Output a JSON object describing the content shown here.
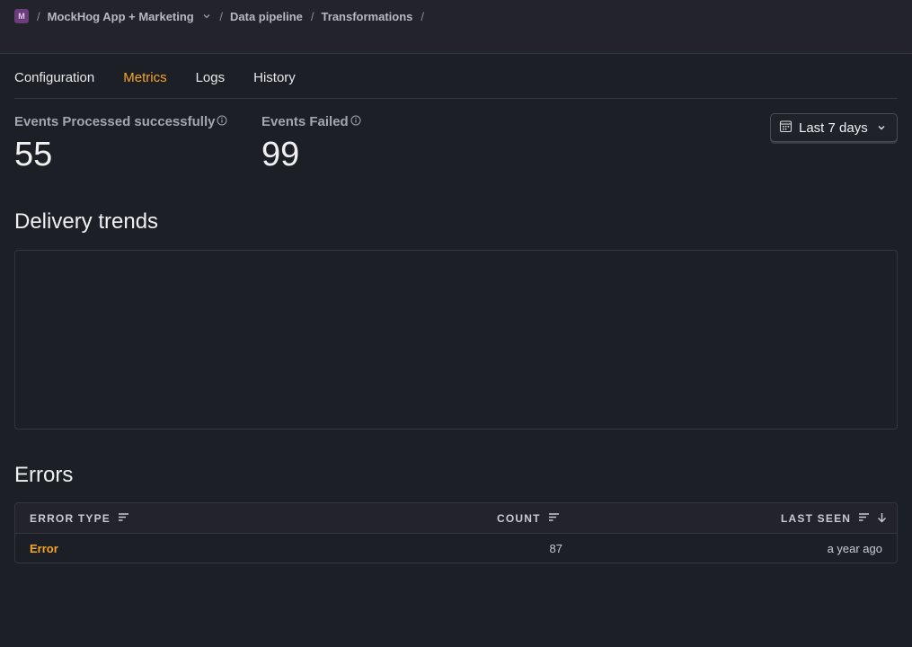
{
  "breadcrumb": {
    "avatar_letter": "M",
    "items": [
      "MockHog App + Marketing",
      "Data pipeline",
      "Transformations"
    ],
    "separator": "/"
  },
  "tabs": [
    {
      "label": "Configuration",
      "active": false
    },
    {
      "label": "Metrics",
      "active": true
    },
    {
      "label": "Logs",
      "active": false
    },
    {
      "label": "History",
      "active": false
    }
  ],
  "stats": {
    "processed": {
      "label": "Events Processed successfully",
      "value": "55"
    },
    "failed": {
      "label": "Events Failed",
      "value": "99"
    }
  },
  "date_range": {
    "label": "Last 7 days"
  },
  "delivery": {
    "title": "Delivery trends"
  },
  "errors": {
    "title": "Errors",
    "columns": {
      "type": "ERROR TYPE",
      "count": "COUNT",
      "last_seen": "LAST SEEN"
    },
    "rows": [
      {
        "type": "Error",
        "count": "87",
        "last_seen": "a year ago"
      }
    ]
  },
  "colors": {
    "accent": "#f5a623",
    "background": "#1d1f27",
    "avatar": "#6b3d7a"
  }
}
